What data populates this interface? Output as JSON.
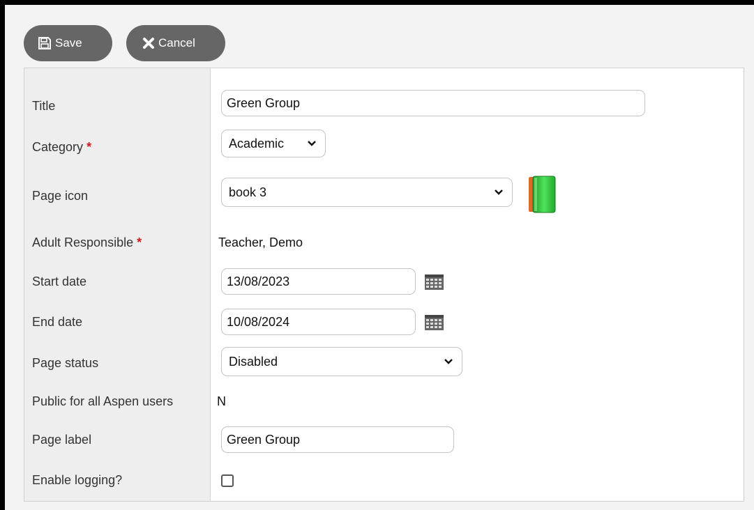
{
  "toolbar": {
    "save_label": "Save",
    "cancel_label": "Cancel"
  },
  "form": {
    "title": {
      "label": "Title",
      "value": "Green Group"
    },
    "category": {
      "label": "Category",
      "required_mark": "*",
      "selected": "Academic"
    },
    "page_icon": {
      "label": "Page icon",
      "selected": "book 3",
      "preview_icon": "green-book-icon"
    },
    "adult_responsible": {
      "label": "Adult Responsible",
      "required_mark": "*",
      "value": "Teacher, Demo"
    },
    "start_date": {
      "label": "Start date",
      "value": "13/08/2023"
    },
    "end_date": {
      "label": "End date",
      "value": "10/08/2024"
    },
    "page_status": {
      "label": "Page status",
      "selected": "Disabled"
    },
    "public": {
      "label": "Public for all Aspen users",
      "value": "N"
    },
    "page_label": {
      "label": "Page label",
      "value": "Green Group"
    },
    "enable_logging": {
      "label": "Enable logging?",
      "checked": false
    }
  },
  "colors": {
    "button_bg": "#666666",
    "label_column_bg": "#eeeeee",
    "required": "#d01c1c",
    "book_green": "#2fbf3a"
  }
}
